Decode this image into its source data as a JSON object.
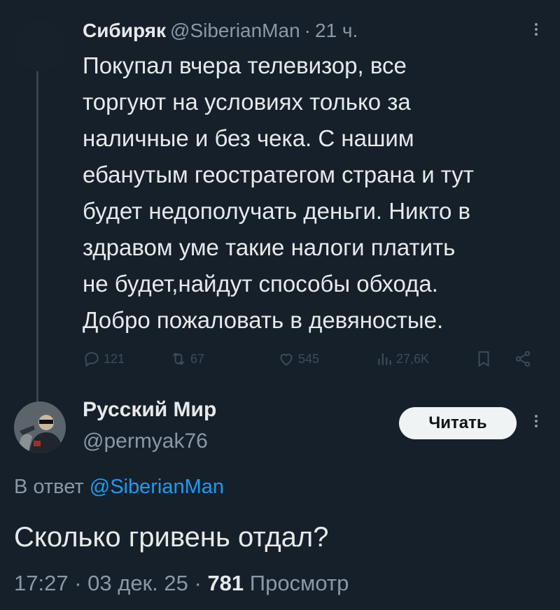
{
  "tweet": {
    "author_name": "Сибиряк",
    "author_handle": "@SiberianMan",
    "separator": "·",
    "time": "21 ч.",
    "lines": [
      "Покупал вчера телевизор, все",
      "торгуют на условиях только за",
      "наличные и без чека. С нашим",
      "ебанутым геостратегом страна и тут",
      "будет недополучать деньги. Никто в",
      "здравом уме такие налоги платить",
      "не будет,найдут способы обхода.",
      "Добро пожаловать в девяностые."
    ],
    "actions": {
      "replies": "121",
      "retweets": "67",
      "likes": "545",
      "views": "27,6K"
    },
    "icons": [
      "reply-icon",
      "retweet-icon",
      "like-icon",
      "views-icon",
      "bookmark-icon",
      "share-icon",
      "more-icon"
    ]
  },
  "reply": {
    "author_name": "Русский Мир",
    "author_handle": "@permyak76",
    "read_button": "Читать",
    "reply_prefix": "В ответ",
    "reply_handle": "@SiberianMan",
    "text": "Сколько гривень отдал?",
    "time": "17:27",
    "date": "03 дек. 25",
    "separator": "·",
    "views_count": "781",
    "views_label": "Просмотр"
  },
  "colors": {
    "background": "#15202b",
    "text": "#e7e9ea",
    "muted": "#8b98a5",
    "link": "#1d9bf0",
    "button_bg": "#eff3f4"
  }
}
